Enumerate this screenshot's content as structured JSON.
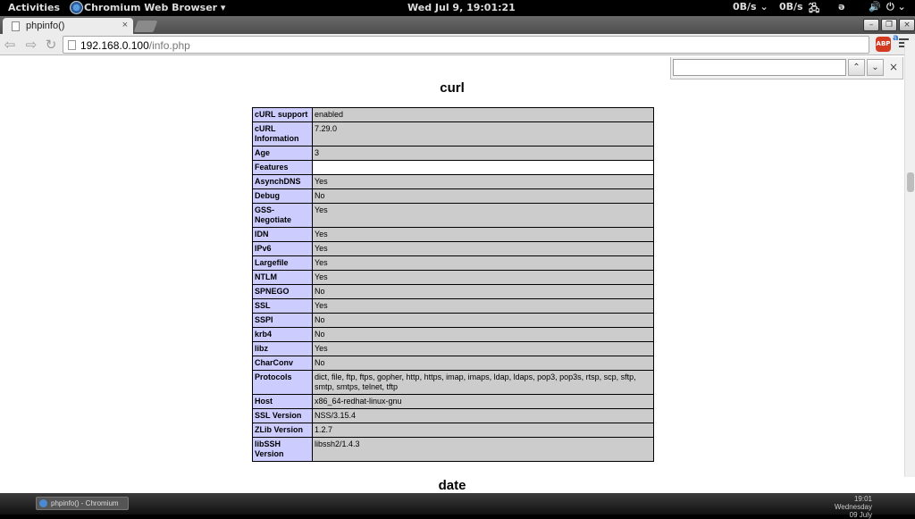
{
  "topbar": {
    "activities": "Activities",
    "app_name": "Chromium Web Browser ▾",
    "clock": "Wed Jul  9, 19:01:21",
    "net_down": "0B/s",
    "net_up": "0B/s"
  },
  "browser": {
    "tab_title": "phpinfo()",
    "url_host": "192.168.0.100",
    "url_path": "/info.php",
    "abp_label": "ABP"
  },
  "page": {
    "section_curl": "curl",
    "section_date": "date",
    "curl_rows": [
      {
        "key": "cURL support",
        "value": "enabled"
      },
      {
        "key": "cURL Information",
        "value": "7.29.0"
      },
      {
        "key": "Age",
        "value": "3"
      },
      {
        "key": "Features",
        "value": ""
      },
      {
        "key": "AsynchDNS",
        "value": "Yes"
      },
      {
        "key": "Debug",
        "value": "No"
      },
      {
        "key": "GSS-Negotiate",
        "value": "Yes"
      },
      {
        "key": "IDN",
        "value": "Yes"
      },
      {
        "key": "IPv6",
        "value": "Yes"
      },
      {
        "key": "Largefile",
        "value": "Yes"
      },
      {
        "key": "NTLM",
        "value": "Yes"
      },
      {
        "key": "SPNEGO",
        "value": "No"
      },
      {
        "key": "SSL",
        "value": "Yes"
      },
      {
        "key": "SSPI",
        "value": "No"
      },
      {
        "key": "krb4",
        "value": "No"
      },
      {
        "key": "libz",
        "value": "Yes"
      },
      {
        "key": "CharConv",
        "value": "No"
      },
      {
        "key": "Protocols",
        "value": "dict, file, ftp, ftps, gopher, http, https, imap, imaps, ldap, ldaps, pop3, pop3s, rtsp, scp, sftp, smtp, smtps, telnet, tftp"
      },
      {
        "key": "Host",
        "value": "x86_64-redhat-linux-gnu"
      },
      {
        "key": "SSL Version",
        "value": "NSS/3.15.4"
      },
      {
        "key": "ZLib Version",
        "value": "1.2.7"
      },
      {
        "key": "libSSH Version",
        "value": "libssh2/1.4.3"
      }
    ]
  },
  "taskbar": {
    "task_label": "phpinfo() - Chromium",
    "clock_time": "19:01",
    "clock_date": "Wednesday 09 July"
  }
}
